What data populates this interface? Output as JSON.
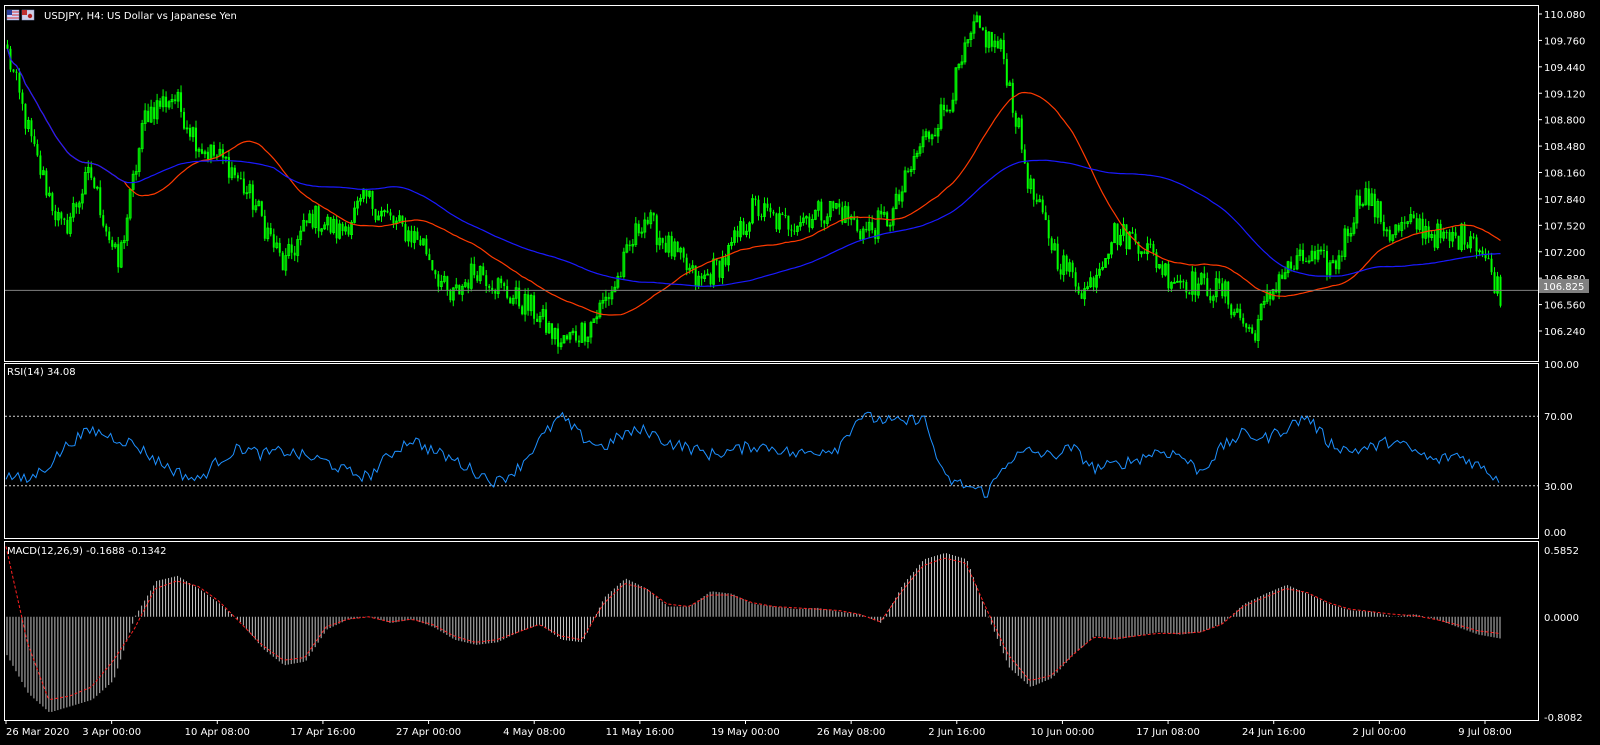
{
  "window": {
    "title": "USDJPY, H4:  US Dollar vs Japanese Yen",
    "flag_icons": [
      "us-flag-icon",
      "japan-flag-icon"
    ]
  },
  "colors": {
    "background": "#000000",
    "frame": "#ffffff",
    "bull_candle": "#00ff00",
    "bear_candle": "#00ff00",
    "ma_fast": "#ff3a00",
    "ma_slow": "#1a1aff",
    "rsi_line": "#1e90ff",
    "macd_hist": "#c0c0c0",
    "macd_signal": "#ff2020",
    "bid_line": "#808080",
    "price_tag_bg": "#808080"
  },
  "price_panel": {
    "ticks": [
      "110.080",
      "109.760",
      "109.440",
      "109.120",
      "108.800",
      "108.480",
      "108.160",
      "107.840",
      "107.520",
      "107.200",
      "106.880",
      "106.560",
      "106.240"
    ],
    "current_price": "106.825"
  },
  "rsi_panel": {
    "label": "RSI(14) 34.08",
    "ticks": [
      "100.00",
      "70.00",
      "30.00",
      "0.00"
    ]
  },
  "macd_panel": {
    "label": "MACD(12,26,9) -0.1688 -0.1342",
    "ticks": [
      "0.5852",
      "0.0000",
      "-0.8082"
    ]
  },
  "time_axis": [
    "26 Mar 2020",
    "3 Apr 00:00",
    "10 Apr 08:00",
    "17 Apr 16:00",
    "27 Apr 00:00",
    "4 May 08:00",
    "11 May 16:00",
    "19 May 00:00",
    "26 May 08:00",
    "2 Jun 16:00",
    "10 Jun 00:00",
    "17 Jun 08:00",
    "24 Jun 16:00",
    "2 Jul 00:00",
    "9 Jul 08:00"
  ],
  "chart_data": [
    {
      "type": "candlestick",
      "title": "USDJPY, H4:  US Dollar vs Japanese Yen",
      "ylim": [
        106.0,
        110.15
      ],
      "x": [
        "26 Mar 2020",
        "3 Apr 00:00",
        "10 Apr 08:00",
        "17 Apr 16:00",
        "27 Apr 00:00",
        "4 May 08:00",
        "11 May 16:00",
        "19 May 00:00",
        "26 May 08:00",
        "2 Jun 16:00",
        "10 Jun 00:00",
        "17 Jun 08:00",
        "24 Jun 16:00",
        "2 Jul 00:00",
        "9 Jul 08:00"
      ],
      "close_path": [
        109.6,
        108.4,
        107.5,
        108.2,
        107.1,
        108.9,
        109.1,
        108.5,
        108.3,
        107.8,
        107.1,
        107.7,
        107.5,
        107.9,
        107.6,
        107.4,
        106.7,
        107.1,
        106.8,
        106.6,
        106.2,
        106.4,
        106.9,
        107.7,
        107.3,
        106.9,
        107.2,
        107.8,
        107.6,
        107.7,
        107.8,
        107.5,
        107.7,
        108.5,
        109.0,
        109.9,
        109.6,
        108.0,
        107.2,
        106.8,
        107.5,
        107.4,
        107.0,
        106.9,
        106.8,
        106.3,
        107.0,
        107.2,
        107.1,
        108.0,
        107.5,
        107.6,
        107.4,
        107.5,
        106.8
      ],
      "series": [
        {
          "name": "",
          "values": [
            106.825
          ]
        }
      ]
    },
    {
      "type": "line",
      "title": "RSI(14) 34.08",
      "ylim": [
        0,
        100
      ],
      "levels": [
        30,
        70
      ],
      "series": [
        {
          "name": "",
          "values": [
            36,
            33,
            42,
            55,
            62,
            58,
            54,
            45,
            38,
            33,
            45,
            52,
            48,
            50,
            47,
            44,
            38,
            35,
            48,
            57,
            50,
            45,
            38,
            32,
            40,
            56,
            70,
            58,
            52,
            60,
            62,
            55,
            52,
            48,
            50,
            53,
            52,
            48,
            50,
            52,
            70,
            68,
            66,
            70,
            34,
            30,
            26,
            45,
            50,
            47,
            52,
            40,
            42,
            45,
            50,
            48,
            38,
            52,
            60,
            57,
            63,
            70,
            55,
            50,
            52,
            56,
            50,
            44,
            48,
            42,
            34
          ]
        }
      ]
    },
    {
      "type": "bar",
      "title": "MACD(12,26,9) -0.1688 -0.1342",
      "ylim": [
        -0.8082,
        0.5852
      ],
      "series": [
        {
          "name": "",
          "values": [
            -0.3,
            -0.6,
            -0.75,
            -0.7,
            -0.65,
            -0.5,
            0.0,
            0.28,
            0.32,
            0.22,
            0.1,
            -0.05,
            -0.25,
            -0.38,
            -0.35,
            -0.1,
            -0.02,
            0.0,
            -0.05,
            -0.02,
            -0.08,
            -0.18,
            -0.22,
            -0.2,
            -0.12,
            -0.06,
            -0.18,
            -0.2,
            0.15,
            0.3,
            0.22,
            0.08,
            0.08,
            0.2,
            0.18,
            0.1,
            0.08,
            0.06,
            0.07,
            0.04,
            0.02,
            -0.05,
            0.25,
            0.45,
            0.5,
            0.45,
            0.0,
            -0.4,
            -0.55,
            -0.48,
            -0.3,
            -0.15,
            -0.18,
            -0.15,
            -0.12,
            -0.14,
            -0.12,
            -0.05,
            0.1,
            0.18,
            0.25,
            0.18,
            0.1,
            0.05,
            0.04,
            0.0,
            0.02,
            -0.02,
            -0.08,
            -0.14,
            -0.17
          ]
        },
        {
          "name": "",
          "values": [
            0.55,
            -0.2,
            -0.65,
            -0.62,
            -0.55,
            -0.35,
            -0.1,
            0.22,
            0.28,
            0.24,
            0.12,
            -0.05,
            -0.22,
            -0.34,
            -0.32,
            -0.08,
            -0.02,
            0.0,
            -0.04,
            -0.02,
            -0.06,
            -0.15,
            -0.2,
            -0.18,
            -0.12,
            -0.06,
            -0.15,
            -0.18,
            0.1,
            0.26,
            0.22,
            0.1,
            0.08,
            0.17,
            0.17,
            0.11,
            0.08,
            0.07,
            0.06,
            0.05,
            0.02,
            -0.04,
            0.2,
            0.4,
            0.46,
            0.42,
            0.05,
            -0.3,
            -0.5,
            -0.46,
            -0.3,
            -0.16,
            -0.17,
            -0.15,
            -0.13,
            -0.13,
            -0.12,
            -0.06,
            0.08,
            0.15,
            0.22,
            0.19,
            0.11,
            0.06,
            0.04,
            0.02,
            0.01,
            -0.02,
            -0.06,
            -0.11,
            -0.13
          ]
        }
      ]
    }
  ]
}
